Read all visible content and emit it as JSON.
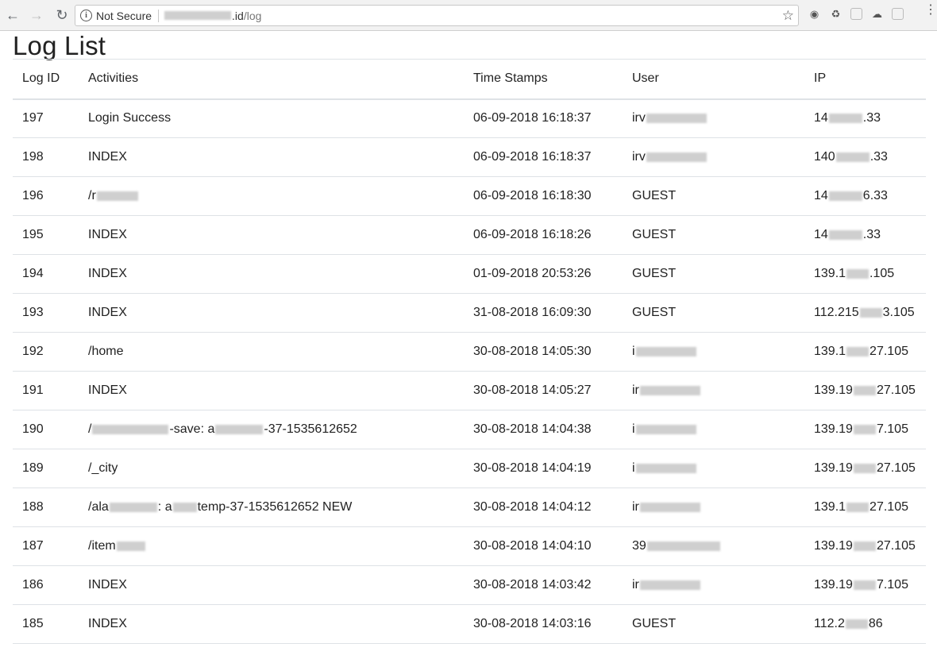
{
  "browser": {
    "security_label": "Not Secure",
    "url_visible": ".id/log",
    "url_host_suffix": ".id",
    "url_path": "/log"
  },
  "page": {
    "title": "Log List"
  },
  "table": {
    "columns": [
      "Log ID",
      "Activities",
      "Time Stamps",
      "User",
      "IP"
    ],
    "rows": [
      {
        "id": "197",
        "activity": "Login Success",
        "timestamp": "06-09-2018 16:18:37",
        "user": "irv",
        "ip": "14",
        "ip_tail": ".33"
      },
      {
        "id": "198",
        "activity": "INDEX",
        "timestamp": "06-09-2018 16:18:37",
        "user": "irv",
        "ip": "140",
        "ip_tail": ".33"
      },
      {
        "id": "196",
        "activity": "/r",
        "timestamp": "06-09-2018 16:18:30",
        "user": "GUEST",
        "ip": "14",
        "ip_tail": "6.33"
      },
      {
        "id": "195",
        "activity": "INDEX",
        "timestamp": "06-09-2018 16:18:26",
        "user": "GUEST",
        "ip": "14",
        "ip_tail": ".33"
      },
      {
        "id": "194",
        "activity": "INDEX",
        "timestamp": "01-09-2018 20:53:26",
        "user": "GUEST",
        "ip": "139.1",
        "ip_tail": ".105"
      },
      {
        "id": "193",
        "activity": "INDEX",
        "timestamp": "31-08-2018 16:09:30",
        "user": "GUEST",
        "ip": "112.215",
        "ip_tail": "3.105"
      },
      {
        "id": "192",
        "activity": "/home",
        "timestamp": "30-08-2018 14:05:30",
        "user": "i",
        "ip": "139.1",
        "ip_tail": "27.105"
      },
      {
        "id": "191",
        "activity": "INDEX",
        "timestamp": "30-08-2018 14:05:27",
        "user": "ir",
        "ip": "139.19",
        "ip_tail": "27.105"
      },
      {
        "id": "190",
        "activity": "/",
        "activity_tail": "-save: a",
        "activity_end": "-37-1535612652",
        "timestamp": "30-08-2018 14:04:38",
        "user": "i",
        "ip": "139.19",
        "ip_tail": "7.105"
      },
      {
        "id": "189",
        "activity": "/_city",
        "timestamp": "30-08-2018 14:04:19",
        "user": "i",
        "ip": "139.19",
        "ip_tail": "27.105"
      },
      {
        "id": "188",
        "activity": "/ala",
        "activity_tail": ": a",
        "activity_end": "temp-37-1535612652 NEW",
        "timestamp": "30-08-2018 14:04:12",
        "user": "ir",
        "ip": "139.1",
        "ip_tail": "27.105"
      },
      {
        "id": "187",
        "activity": "/item",
        "timestamp": "30-08-2018 14:04:10",
        "user": "39",
        "ip": "139.19",
        "ip_tail": "27.105"
      },
      {
        "id": "186",
        "activity": "INDEX",
        "timestamp": "30-08-2018 14:03:42",
        "user": "ir",
        "ip": "139.19",
        "ip_tail": "7.105"
      },
      {
        "id": "185",
        "activity": "INDEX",
        "timestamp": "30-08-2018 14:03:16",
        "user": "GUEST",
        "ip": "112.2",
        "ip_tail": "86"
      }
    ]
  }
}
